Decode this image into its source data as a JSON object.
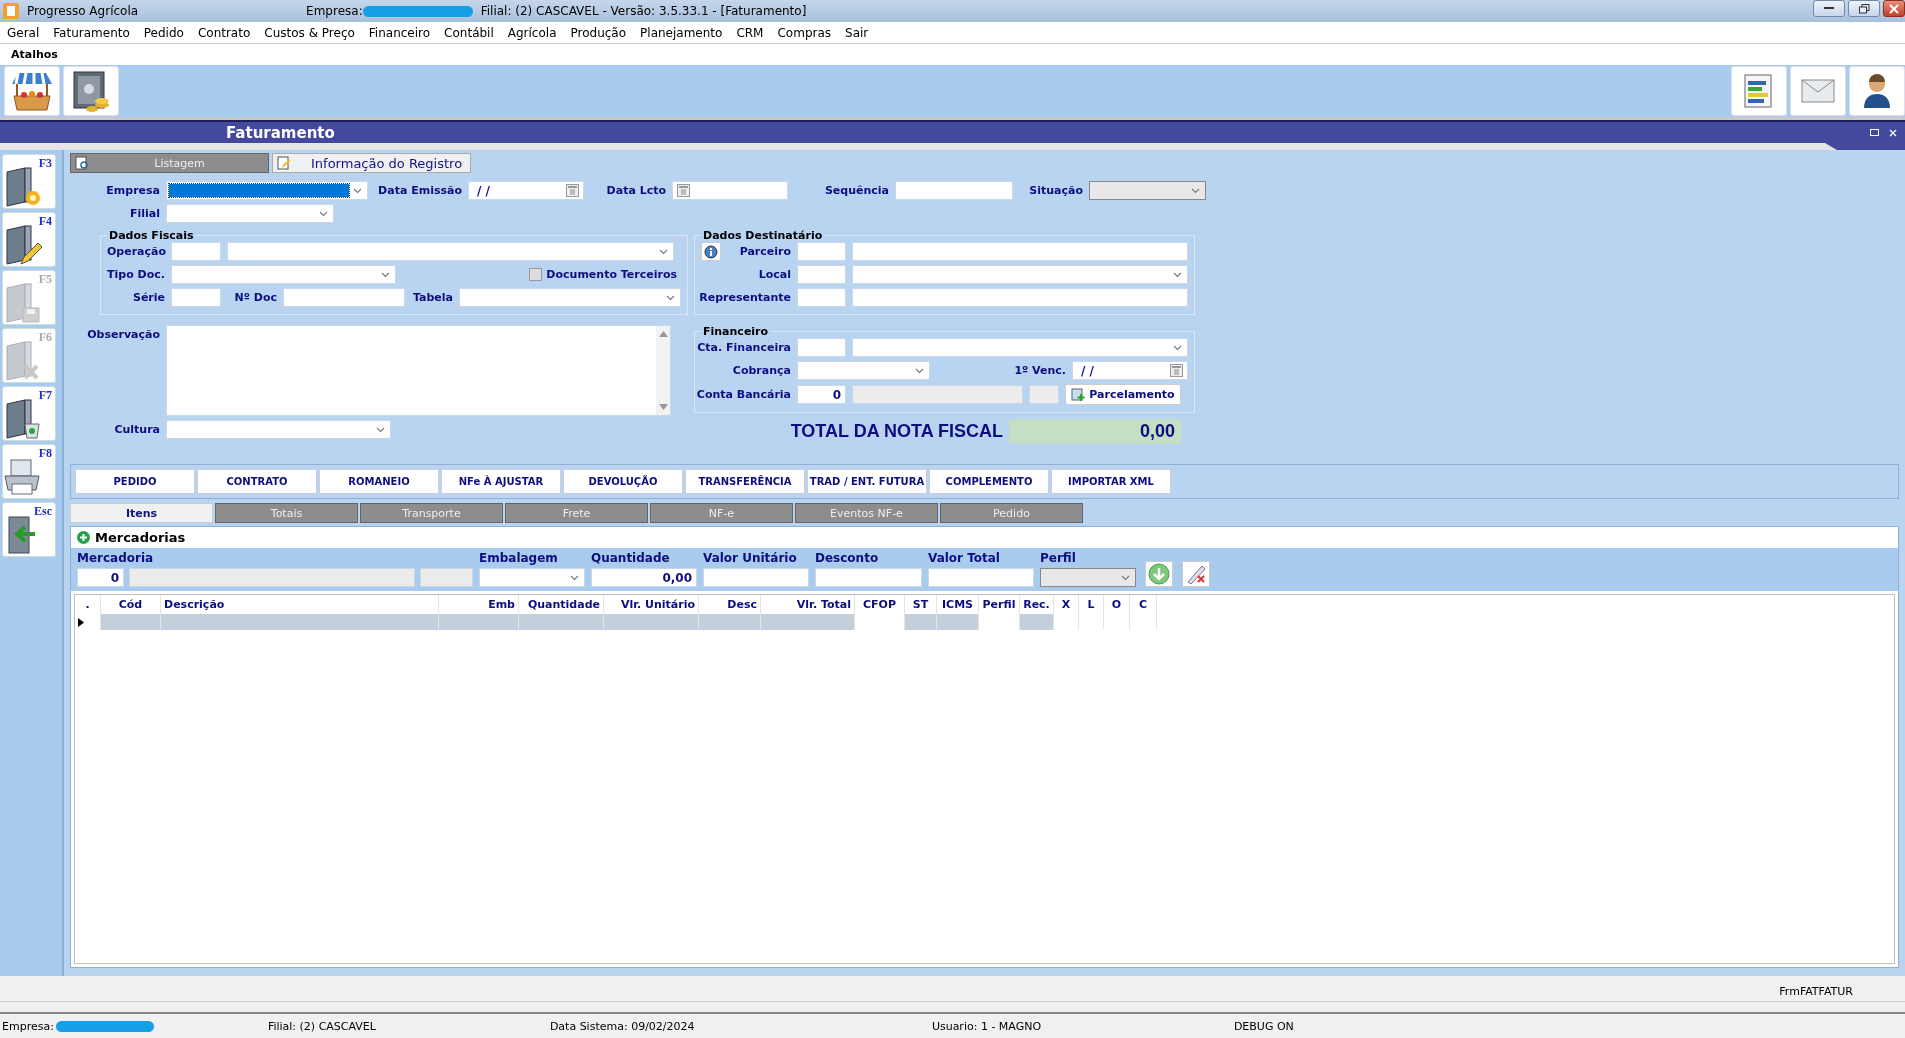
{
  "window": {
    "app_name": "Progresso Agrícola",
    "empresa_label": "Empresa:",
    "title_info": "Filial: (2) CASCAVEL - Versão: 3.5.33.1 - [Faturamento]"
  },
  "menu": [
    "Geral",
    "Faturamento",
    "Pedido",
    "Contrato",
    "Custos & Preço",
    "Financeiro",
    "Contábil",
    "Agrícola",
    "Produção",
    "Planejamento",
    "CRM",
    "Compras",
    "Sair"
  ],
  "shortcuts": {
    "label": "Atalhos",
    "left": [
      {
        "kind": "market"
      },
      {
        "kind": "safe"
      }
    ],
    "right": [
      {
        "kind": "report"
      },
      {
        "kind": "mail"
      },
      {
        "kind": "user"
      }
    ]
  },
  "form_window": {
    "title": "Faturamento"
  },
  "side_toolbar": [
    {
      "key": "F3",
      "kind": "new",
      "disabled": false
    },
    {
      "key": "F4",
      "kind": "edit",
      "disabled": false
    },
    {
      "key": "F5",
      "kind": "save",
      "disabled": true
    },
    {
      "key": "F6",
      "kind": "cancel",
      "disabled": true
    },
    {
      "key": "F7",
      "kind": "trash",
      "disabled": false
    },
    {
      "key": "F8",
      "kind": "print",
      "disabled": false
    },
    {
      "key": "Esc",
      "kind": "exit",
      "disabled": false
    }
  ],
  "tabs": [
    {
      "label": "Listagem",
      "selected": false
    },
    {
      "label": "Informação do Registro",
      "selected": true
    }
  ],
  "empresa": {
    "label": "Empresa",
    "focused": true
  },
  "data_emissao": {
    "label": "Data Emissão",
    "value": "/ /"
  },
  "data_lcto": {
    "label": "Data Lcto"
  },
  "sequencia": {
    "label": "Sequência"
  },
  "situacao": {
    "label": "Situação",
    "disabled": true
  },
  "filial": {
    "label": "Filial"
  },
  "dados_fiscais": {
    "title": "Dados Fiscais",
    "operacao": "Operação",
    "tipo_doc": "Tipo Doc.",
    "documento_terceiros": {
      "label": "Documento Terceiros",
      "checked": false
    },
    "serie": "Série",
    "n_doc": "Nº Doc",
    "tabela": "Tabela"
  },
  "observacao": {
    "label": "Observação"
  },
  "cultura": {
    "label": "Cultura"
  },
  "dados_destinatario": {
    "title": "Dados Destinatário",
    "parceiro": "Parceiro",
    "local": "Local",
    "representante": "Representante"
  },
  "financeiro": {
    "title": "Financeiro",
    "cta_financeira": "Cta. Financeira",
    "cobranca": "Cobrança",
    "primeiro_venc": {
      "label": "1º Venc.",
      "value": "/ /"
    },
    "conta_bancaria": {
      "label": "Conta Bancária",
      "value": "0"
    },
    "parcelamento_button": "Parcelamento"
  },
  "total": {
    "label": "TOTAL DA NOTA FISCAL",
    "value": "0,00"
  },
  "action_buttons": [
    "PEDIDO",
    "CONTRATO",
    "ROMANEIO",
    "NFe À AJUSTAR",
    "DEVOLUÇÃO",
    "TRANSFERÊNCIA",
    "TRAD / ENT. FUTURA",
    "COMPLEMENTO",
    "IMPORTAR XML"
  ],
  "item_tabs": [
    {
      "label": "Itens",
      "selected": true
    },
    {
      "label": "Totais",
      "selected": false
    },
    {
      "label": "Transporte",
      "selected": false
    },
    {
      "label": "Frete",
      "selected": false
    },
    {
      "label": "NF-e",
      "selected": false
    },
    {
      "label": "Eventos NF-e",
      "selected": false
    },
    {
      "label": "Pedido",
      "selected": false
    }
  ],
  "mercadorias": {
    "title": "Mercadorias",
    "mercadoria": {
      "label": "Mercadoria",
      "value": "0"
    },
    "embalagem": "Embalagem",
    "quantidade": {
      "label": "Quantidade",
      "value": "0,00"
    },
    "valor_unitario": "Valor Unitário",
    "desconto": "Desconto",
    "valor_total": "Valor Total",
    "perfil": {
      "label": "Perfil",
      "disabled": true
    }
  },
  "table": {
    "columns": [
      ".",
      "Cód",
      "Descrição",
      "Emb",
      "Quantidade",
      "Vlr. Unitário",
      "Desc",
      "Vlr. Total",
      "CFOP",
      "ST",
      "ICMS",
      "Perfil",
      "Rec.",
      "X",
      "L",
      "O",
      "C"
    ],
    "rows": [
      {
        "selected": true
      }
    ]
  },
  "form_name": "FrmFATFATUR",
  "status_bar": {
    "empresa_label": "Empresa:",
    "filial": "Filial: (2) CASCAVEL",
    "data_sistema": "Data Sistema: 09/02/2024",
    "usuario": "Usuario: 1 - MAGNO",
    "debug": "DEBUG ON"
  }
}
